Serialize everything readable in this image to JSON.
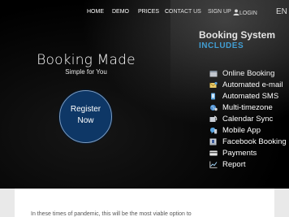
{
  "nav": {
    "items": [
      "HOME",
      "DEMO",
      "PRICES",
      "CONTACT US",
      "SIGN UP",
      "LOGIN"
    ],
    "language": "EN",
    "login_icon": "user-icon"
  },
  "hero": {
    "title": "Booking Made",
    "subtitle": "Simple for You",
    "register_line1": "Register",
    "register_line2": "Now"
  },
  "panel": {
    "title": "Booking System",
    "subtitle": "INCLUDES",
    "features": [
      {
        "label": "Online Booking",
        "icon": "calendar-icon"
      },
      {
        "label": "Automated e-mail",
        "icon": "envelope-icon"
      },
      {
        "label": "Automated SMS",
        "icon": "sms-icon"
      },
      {
        "label": "Multi-timezone",
        "icon": "globe-icon"
      },
      {
        "label": "Calendar Sync",
        "icon": "sync-icon"
      },
      {
        "label": "Mobile App",
        "icon": "mobile-icon"
      },
      {
        "label": "Facebook Booking",
        "icon": "facebook-icon"
      },
      {
        "label": "Payments",
        "icon": "credit-card-icon"
      },
      {
        "label": "Report",
        "icon": "chart-icon"
      }
    ]
  },
  "content": {
    "intro": "In these times of pandemic, this will be the most viable option to"
  },
  "colors": {
    "accent": "#3da8e6",
    "button": "#0e3766"
  }
}
